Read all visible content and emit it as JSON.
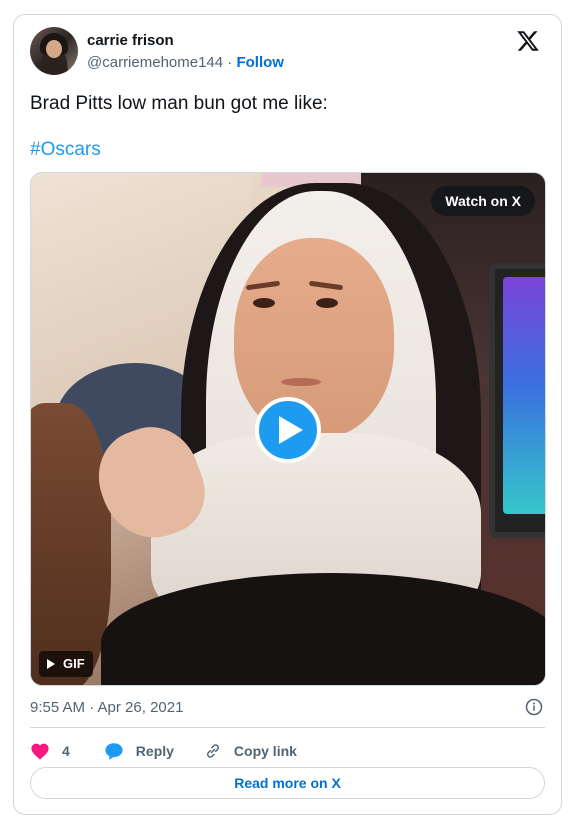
{
  "author": {
    "name": "carrie frison",
    "handle": "@carriemehome144",
    "separator": "·",
    "follow_label": "Follow"
  },
  "tweet": {
    "text": "Brad Pitts low man bun got me like:",
    "hashtag": "#Oscars"
  },
  "media": {
    "watch_label": "Watch on X",
    "badge_label": "GIF",
    "play_icon": "play-icon"
  },
  "meta": {
    "timestamp": "9:55 AM · Apr 26, 2021"
  },
  "actions": {
    "like_count": "4",
    "reply_label": "Reply",
    "copy_link_label": "Copy link"
  },
  "footer": {
    "read_more_label": "Read more on X"
  },
  "colors": {
    "accent": "#1d9bf0",
    "link": "#006fd6",
    "like": "#f91880",
    "muted": "#536471",
    "border": "#cfd9de"
  }
}
